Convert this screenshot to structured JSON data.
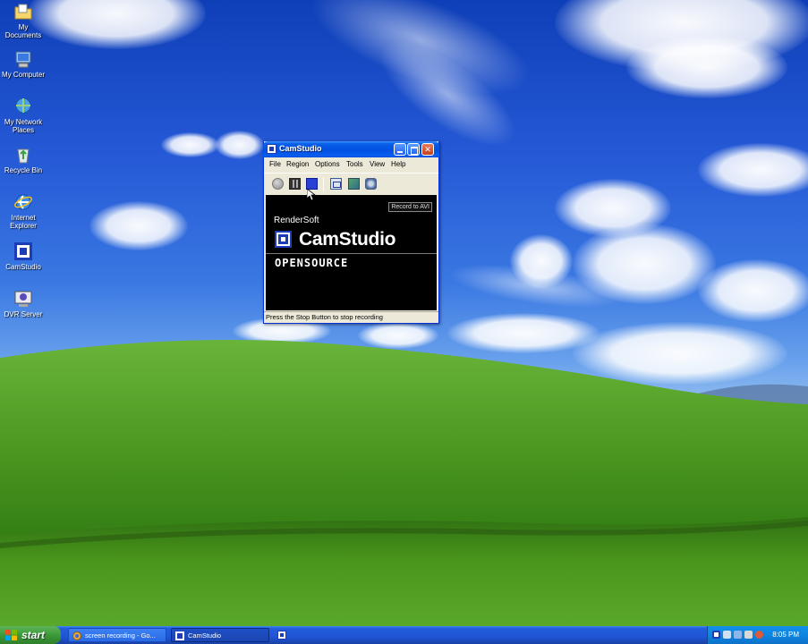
{
  "desktop": {
    "icons": [
      {
        "label": "My Documents",
        "icon": "folder-documents-icon"
      },
      {
        "label": "My Computer",
        "icon": "computer-icon"
      },
      {
        "label": "My Network Places",
        "icon": "network-icon"
      },
      {
        "label": "Recycle Bin",
        "icon": "recycle-bin-icon"
      },
      {
        "label": "Internet Explorer",
        "icon": "internet-explorer-icon"
      },
      {
        "label": "CamStudio",
        "icon": "camstudio-icon"
      },
      {
        "label": "DVR Server",
        "icon": "dvr-server-icon"
      }
    ]
  },
  "window": {
    "title": "CamStudio",
    "menu": [
      "File",
      "Region",
      "Options",
      "Tools",
      "View",
      "Help"
    ],
    "toolbar": [
      "record",
      "pause",
      "stop",
      "region",
      "annotations",
      "settings"
    ],
    "tooltip": "Record to AVI",
    "brand": {
      "company": "RenderSoft",
      "name": "CamStudio",
      "tagline": "OPENSOURCE"
    },
    "status": "Press the Stop Button to stop recording"
  },
  "taskbar": {
    "start_label": "start",
    "tasks": [
      {
        "label": "screen recording - Go...",
        "icon": "browser-icon"
      },
      {
        "label": "CamStudio",
        "icon": "camstudio-icon"
      }
    ],
    "clock": "8:05 PM"
  },
  "colors": {
    "titlebar": "#0a5fe8",
    "taskbar": "#245edb",
    "start": "#3c9a39",
    "camstudio_blue": "#1c3cb8"
  }
}
